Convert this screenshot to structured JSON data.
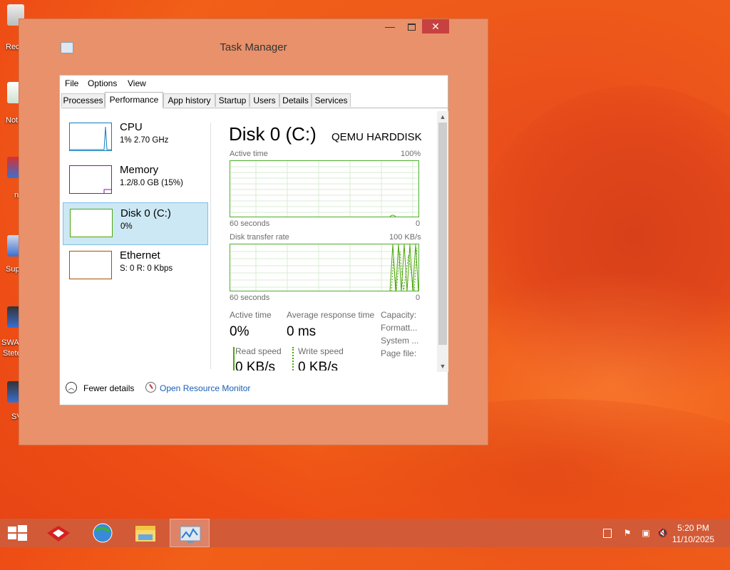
{
  "desktop": {
    "icons": [
      {
        "label": "Rec"
      },
      {
        "label": "Not"
      },
      {
        "label": "n"
      },
      {
        "label": "Sup"
      },
      {
        "label": "SWA"
      },
      {
        "label": "Stete"
      },
      {
        "label": "SV"
      }
    ]
  },
  "window": {
    "title": "Task Manager",
    "controls": {
      "minimize": "—",
      "maximize": "",
      "close": "✕"
    }
  },
  "menu": [
    "File",
    "Options",
    "View"
  ],
  "tabs": [
    "Processes",
    "Performance",
    "App history",
    "Startup",
    "Users",
    "Details",
    "Services"
  ],
  "active_tab": "Performance",
  "resources": [
    {
      "name": "CPU",
      "value": "1% 2.70 GHz",
      "color": "#117dbb"
    },
    {
      "name": "Memory",
      "value": "1.2/8.0 GB (15%)",
      "color": "#8b12ae"
    },
    {
      "name": "Disk 0 (C:)",
      "value": "0%",
      "color": "#4da60c"
    },
    {
      "name": "Ethernet",
      "value": "S: 0 R: 0 Kbps",
      "color": "#a74f01"
    }
  ],
  "detail": {
    "title": "Disk 0 (C:)",
    "model": "QEMU HARDDISK",
    "graph1": {
      "label": "Active time",
      "max": "100%",
      "time": "60 seconds",
      "min": "0"
    },
    "graph2": {
      "label": "Disk transfer rate",
      "max": "100 KB/s",
      "time": "60 seconds",
      "min": "0"
    },
    "stats": {
      "active_time_label": "Active time",
      "active_time_value": "0%",
      "avg_resp_label": "Average response time",
      "avg_resp_value": "0 ms",
      "read_label": "Read speed",
      "read_value": "0 KB/s",
      "write_label": "Write speed",
      "write_value": "0 KB/s"
    },
    "props": [
      "Capacity:",
      "Formatt...",
      "System ...",
      "Page file:"
    ]
  },
  "footer": {
    "fewer": "Fewer details",
    "resmon": "Open Resource Monitor"
  },
  "taskbar": {
    "time": "5:20 PM",
    "date": "11/10/2025"
  },
  "colors": {
    "accent_close": "#c74141",
    "link": "#1a5fb4",
    "window_frame": "#e8916a"
  }
}
